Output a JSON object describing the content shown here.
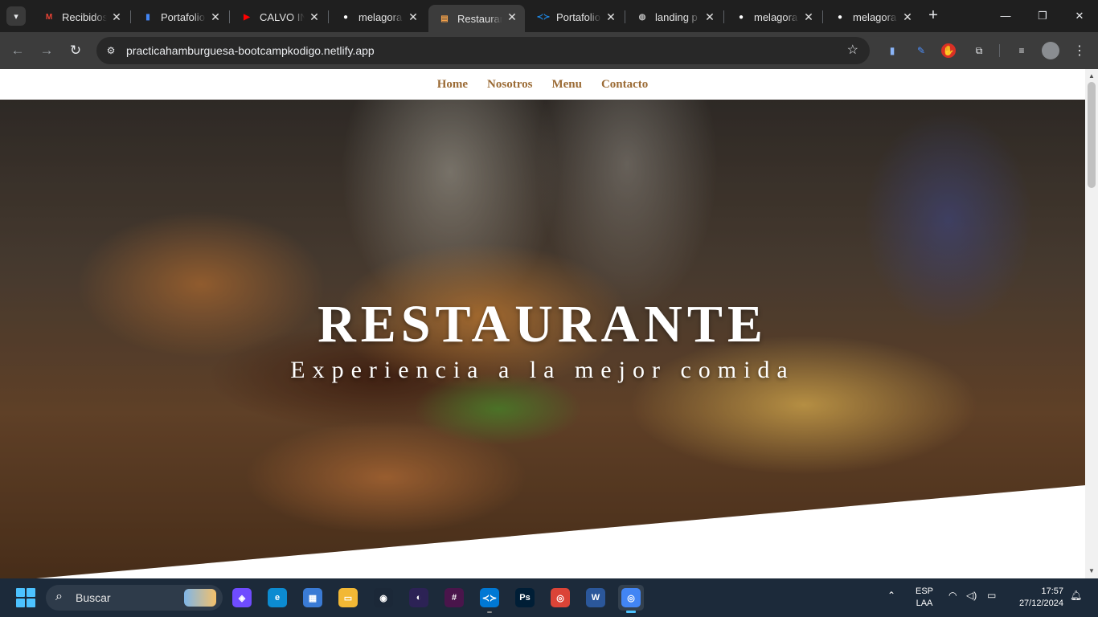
{
  "browser": {
    "tabs": [
      {
        "title": "Recibidos",
        "icon": "gmail-icon",
        "color": "#ea4335",
        "glyph": "M"
      },
      {
        "title": "Portafolio",
        "icon": "docs-icon",
        "color": "#4285f4",
        "glyph": "▮"
      },
      {
        "title": "CALVO IN",
        "icon": "youtube-icon",
        "color": "#ff0000",
        "glyph": "▶"
      },
      {
        "title": "melagora",
        "icon": "github-icon",
        "color": "#ffffff",
        "glyph": "●"
      },
      {
        "title": "Restauran",
        "icon": "restaurant-icon",
        "color": "#f4a14a",
        "glyph": "▤",
        "active": true
      },
      {
        "title": "Portafolio",
        "icon": "vscode-web-icon",
        "color": "#1e88e5",
        "glyph": "≺≻"
      },
      {
        "title": "landing p",
        "icon": "globe-icon",
        "color": "#bdbdbd",
        "glyph": "◍"
      },
      {
        "title": "melagora",
        "icon": "github-icon",
        "color": "#ffffff",
        "glyph": "●"
      },
      {
        "title": "melagora",
        "icon": "github-icon",
        "color": "#ffffff",
        "glyph": "●"
      }
    ],
    "url": "practicahamburguesa-bootcampkodigo.netlify.app"
  },
  "site": {
    "nav": [
      "Home",
      "Nosotros",
      "Menu",
      "Contacto"
    ],
    "hero_title": "RESTAURANTE",
    "hero_subtitle": "Experiencia a la mejor comida",
    "accent_color": "#9b6b35"
  },
  "taskbar": {
    "search_label": "Buscar",
    "apps": [
      {
        "name": "copilot-icon",
        "bg": "#6f4cff",
        "glyph": "◈"
      },
      {
        "name": "edge-icon",
        "bg": "#0c8bd1",
        "glyph": "e"
      },
      {
        "name": "store-icon",
        "bg": "#3a7bd5",
        "glyph": "▦"
      },
      {
        "name": "file-explorer-icon",
        "bg": "#f2b835",
        "glyph": "▭"
      },
      {
        "name": "steam-icon",
        "bg": "#1b2838",
        "glyph": "◉"
      },
      {
        "name": "eclipse-icon",
        "bg": "#2c2255",
        "glyph": "◐"
      },
      {
        "name": "slack-icon",
        "bg": "#4a154b",
        "glyph": "#"
      },
      {
        "name": "vscode-icon",
        "bg": "#0078d4",
        "glyph": "≺≻",
        "running": true
      },
      {
        "name": "photoshop-icon",
        "bg": "#001e36",
        "glyph": "Ps"
      },
      {
        "name": "chrome-icon",
        "bg": "#db4437",
        "glyph": "◎"
      },
      {
        "name": "word-icon",
        "bg": "#2b579a",
        "glyph": "W"
      },
      {
        "name": "chrome-profile-icon",
        "bg": "#4285f4",
        "glyph": "◎",
        "active": true
      }
    ],
    "lang_top": "ESP",
    "lang_bottom": "LAA",
    "time": "17:57",
    "date": "27/12/2024"
  }
}
